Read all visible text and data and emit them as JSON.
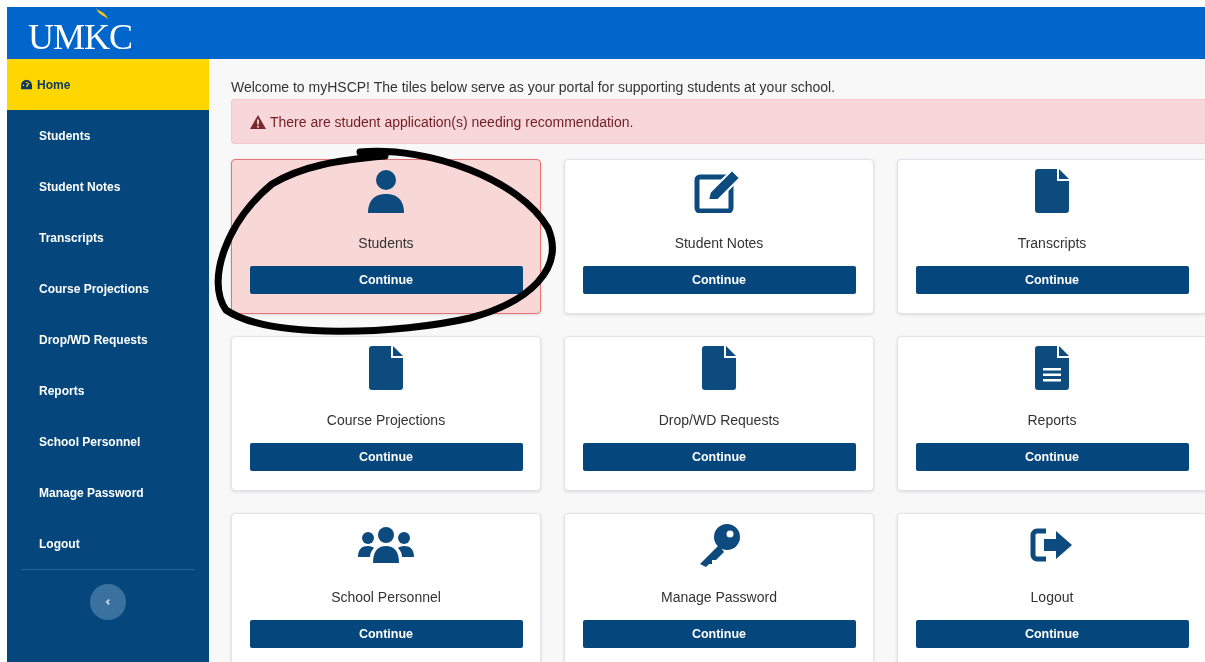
{
  "header": {
    "logo": "UMKC"
  },
  "sidebar": {
    "items": [
      {
        "label": "Home",
        "selected": true
      },
      {
        "label": "Students",
        "selected": false
      },
      {
        "label": "Student Notes",
        "selected": false
      },
      {
        "label": "Transcripts",
        "selected": false
      },
      {
        "label": "Course Projections",
        "selected": false
      },
      {
        "label": "Drop/WD Requests",
        "selected": false
      },
      {
        "label": "Reports",
        "selected": false
      },
      {
        "label": "School Personnel",
        "selected": false
      },
      {
        "label": "Manage Password",
        "selected": false
      },
      {
        "label": "Logout",
        "selected": false
      }
    ]
  },
  "welcome": "Welcome to myHSCP! The tiles below serve as your portal for supporting students at your school.",
  "alert": "There are student application(s) needing recommendation.",
  "tiles": [
    {
      "label": "Students",
      "button": "Continue",
      "selected": true
    },
    {
      "label": "Student Notes",
      "button": "Continue",
      "selected": false
    },
    {
      "label": "Transcripts",
      "button": "Continue",
      "selected": false
    },
    {
      "label": "Course Projections",
      "button": "Continue",
      "selected": false
    },
    {
      "label": "Drop/WD Requests",
      "button": "Continue",
      "selected": false
    },
    {
      "label": "Reports",
      "button": "Continue",
      "selected": false
    },
    {
      "label": "School Personnel",
      "button": "Continue",
      "selected": false
    },
    {
      "label": "Manage Password",
      "button": "Continue",
      "selected": false
    },
    {
      "label": "Logout",
      "button": "Continue",
      "selected": false
    }
  ]
}
